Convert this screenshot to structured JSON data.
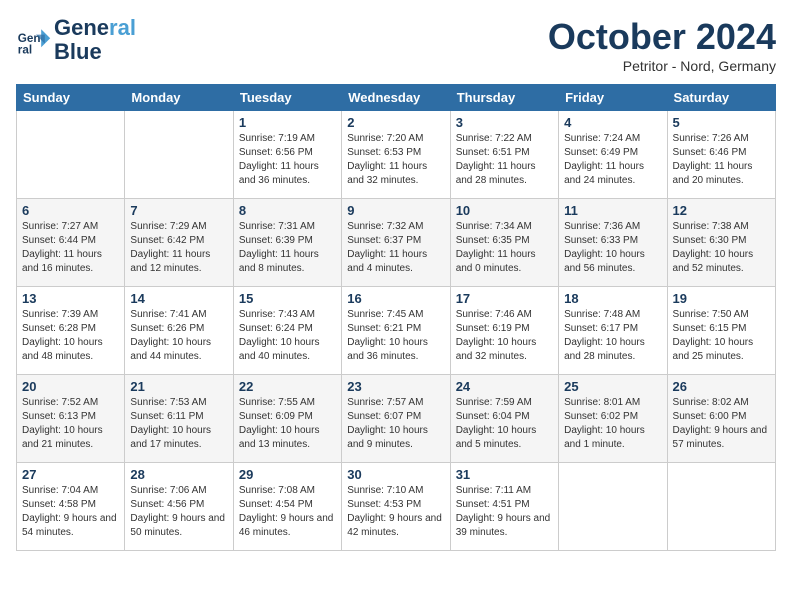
{
  "header": {
    "logo_line1": "General",
    "logo_line2": "Blue",
    "month": "October 2024",
    "location": "Petritor - Nord, Germany"
  },
  "weekdays": [
    "Sunday",
    "Monday",
    "Tuesday",
    "Wednesday",
    "Thursday",
    "Friday",
    "Saturday"
  ],
  "weeks": [
    [
      null,
      null,
      {
        "day": 1,
        "sunrise": "7:19 AM",
        "sunset": "6:56 PM",
        "daylight": "11 hours and 36 minutes."
      },
      {
        "day": 2,
        "sunrise": "7:20 AM",
        "sunset": "6:53 PM",
        "daylight": "11 hours and 32 minutes."
      },
      {
        "day": 3,
        "sunrise": "7:22 AM",
        "sunset": "6:51 PM",
        "daylight": "11 hours and 28 minutes."
      },
      {
        "day": 4,
        "sunrise": "7:24 AM",
        "sunset": "6:49 PM",
        "daylight": "11 hours and 24 minutes."
      },
      {
        "day": 5,
        "sunrise": "7:26 AM",
        "sunset": "6:46 PM",
        "daylight": "11 hours and 20 minutes."
      }
    ],
    [
      {
        "day": 6,
        "sunrise": "7:27 AM",
        "sunset": "6:44 PM",
        "daylight": "11 hours and 16 minutes."
      },
      {
        "day": 7,
        "sunrise": "7:29 AM",
        "sunset": "6:42 PM",
        "daylight": "11 hours and 12 minutes."
      },
      {
        "day": 8,
        "sunrise": "7:31 AM",
        "sunset": "6:39 PM",
        "daylight": "11 hours and 8 minutes."
      },
      {
        "day": 9,
        "sunrise": "7:32 AM",
        "sunset": "6:37 PM",
        "daylight": "11 hours and 4 minutes."
      },
      {
        "day": 10,
        "sunrise": "7:34 AM",
        "sunset": "6:35 PM",
        "daylight": "11 hours and 0 minutes."
      },
      {
        "day": 11,
        "sunrise": "7:36 AM",
        "sunset": "6:33 PM",
        "daylight": "10 hours and 56 minutes."
      },
      {
        "day": 12,
        "sunrise": "7:38 AM",
        "sunset": "6:30 PM",
        "daylight": "10 hours and 52 minutes."
      }
    ],
    [
      {
        "day": 13,
        "sunrise": "7:39 AM",
        "sunset": "6:28 PM",
        "daylight": "10 hours and 48 minutes."
      },
      {
        "day": 14,
        "sunrise": "7:41 AM",
        "sunset": "6:26 PM",
        "daylight": "10 hours and 44 minutes."
      },
      {
        "day": 15,
        "sunrise": "7:43 AM",
        "sunset": "6:24 PM",
        "daylight": "10 hours and 40 minutes."
      },
      {
        "day": 16,
        "sunrise": "7:45 AM",
        "sunset": "6:21 PM",
        "daylight": "10 hours and 36 minutes."
      },
      {
        "day": 17,
        "sunrise": "7:46 AM",
        "sunset": "6:19 PM",
        "daylight": "10 hours and 32 minutes."
      },
      {
        "day": 18,
        "sunrise": "7:48 AM",
        "sunset": "6:17 PM",
        "daylight": "10 hours and 28 minutes."
      },
      {
        "day": 19,
        "sunrise": "7:50 AM",
        "sunset": "6:15 PM",
        "daylight": "10 hours and 25 minutes."
      }
    ],
    [
      {
        "day": 20,
        "sunrise": "7:52 AM",
        "sunset": "6:13 PM",
        "daylight": "10 hours and 21 minutes."
      },
      {
        "day": 21,
        "sunrise": "7:53 AM",
        "sunset": "6:11 PM",
        "daylight": "10 hours and 17 minutes."
      },
      {
        "day": 22,
        "sunrise": "7:55 AM",
        "sunset": "6:09 PM",
        "daylight": "10 hours and 13 minutes."
      },
      {
        "day": 23,
        "sunrise": "7:57 AM",
        "sunset": "6:07 PM",
        "daylight": "10 hours and 9 minutes."
      },
      {
        "day": 24,
        "sunrise": "7:59 AM",
        "sunset": "6:04 PM",
        "daylight": "10 hours and 5 minutes."
      },
      {
        "day": 25,
        "sunrise": "8:01 AM",
        "sunset": "6:02 PM",
        "daylight": "10 hours and 1 minute."
      },
      {
        "day": 26,
        "sunrise": "8:02 AM",
        "sunset": "6:00 PM",
        "daylight": "9 hours and 57 minutes."
      }
    ],
    [
      {
        "day": 27,
        "sunrise": "7:04 AM",
        "sunset": "4:58 PM",
        "daylight": "9 hours and 54 minutes."
      },
      {
        "day": 28,
        "sunrise": "7:06 AM",
        "sunset": "4:56 PM",
        "daylight": "9 hours and 50 minutes."
      },
      {
        "day": 29,
        "sunrise": "7:08 AM",
        "sunset": "4:54 PM",
        "daylight": "9 hours and 46 minutes."
      },
      {
        "day": 30,
        "sunrise": "7:10 AM",
        "sunset": "4:53 PM",
        "daylight": "9 hours and 42 minutes."
      },
      {
        "day": 31,
        "sunrise": "7:11 AM",
        "sunset": "4:51 PM",
        "daylight": "9 hours and 39 minutes."
      },
      null,
      null
    ]
  ]
}
